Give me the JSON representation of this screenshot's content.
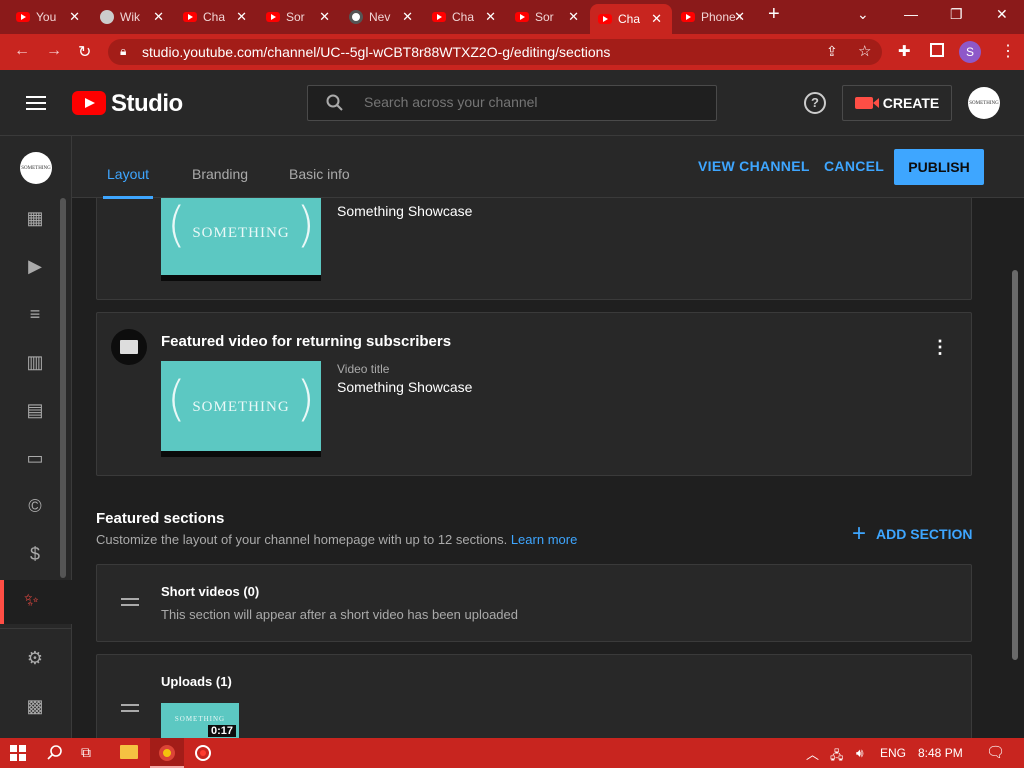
{
  "browser": {
    "tabs": [
      {
        "title": "YouTube",
        "favicon": "youtube-icon"
      },
      {
        "title": "Wikipedia",
        "favicon": "wiki-icon"
      },
      {
        "title": "Channel",
        "favicon": "youtube-icon"
      },
      {
        "title": "Something",
        "favicon": "youtube-icon"
      },
      {
        "title": "New Tab",
        "favicon": "chrome-icon"
      },
      {
        "title": "Channel",
        "favicon": "youtube-icon"
      },
      {
        "title": "Something",
        "favicon": "youtube-icon"
      },
      {
        "title": "Channel",
        "favicon": "youtube-icon"
      },
      {
        "title": "Phone videos",
        "favicon": "youtube-icon"
      }
    ],
    "tab_labels": [
      "You",
      "Wik",
      "Cha",
      "Sor",
      "Nev",
      "Cha",
      "Sor",
      "Cha",
      "Phone v"
    ],
    "url": "studio.youtube.com/channel/UC--5gl-wCBT8r88WTXZ2O-g/editing/sections",
    "profile_initial": "S"
  },
  "header": {
    "logo_text": "Studio",
    "search_placeholder": "Search across your channel",
    "create_label": "CREATE",
    "avatar_text": "SOMETHING"
  },
  "sidebar": {
    "avatar_text": "SOMETHING",
    "items": [
      "dashboard-icon",
      "content-icon",
      "playlists-icon",
      "analytics-icon",
      "comments-icon",
      "subtitles-icon",
      "copyright-icon",
      "monetization-icon",
      "customization-icon",
      "settings-icon",
      "feedback-icon"
    ]
  },
  "page_tabs": {
    "layout": "Layout",
    "branding": "Branding",
    "basic_info": "Basic info"
  },
  "actions": {
    "view_channel": "VIEW CHANNEL",
    "cancel": "CANCEL",
    "publish": "PUBLISH"
  },
  "spotlight": {
    "first_card": {
      "video_title": "Something Showcase",
      "thumb_word": "SOMETHING"
    },
    "returning": {
      "heading": "Featured video for returning subscribers",
      "video_title_label": "Video title",
      "video_title": "Something Showcase",
      "thumb_word": "SOMETHING"
    }
  },
  "featured_sections": {
    "heading": "Featured sections",
    "description": "Customize the layout of your channel homepage with up to 12 sections.",
    "learn_more": "Learn more",
    "add_section": "ADD SECTION",
    "items": [
      {
        "title": "Short videos (0)",
        "subtitle": "This section will appear after a short video has been uploaded"
      },
      {
        "title": "Uploads (1)",
        "duration": "0:17",
        "thumb_word": "SOMETHING"
      }
    ]
  },
  "taskbar": {
    "language": "ENG",
    "time": "8:48 PM"
  },
  "colors": {
    "accent": "#3ea6ff",
    "brand_red": "#ff0000",
    "chrome_red": "#c8251f",
    "thumb_teal": "#5cc8c2"
  }
}
